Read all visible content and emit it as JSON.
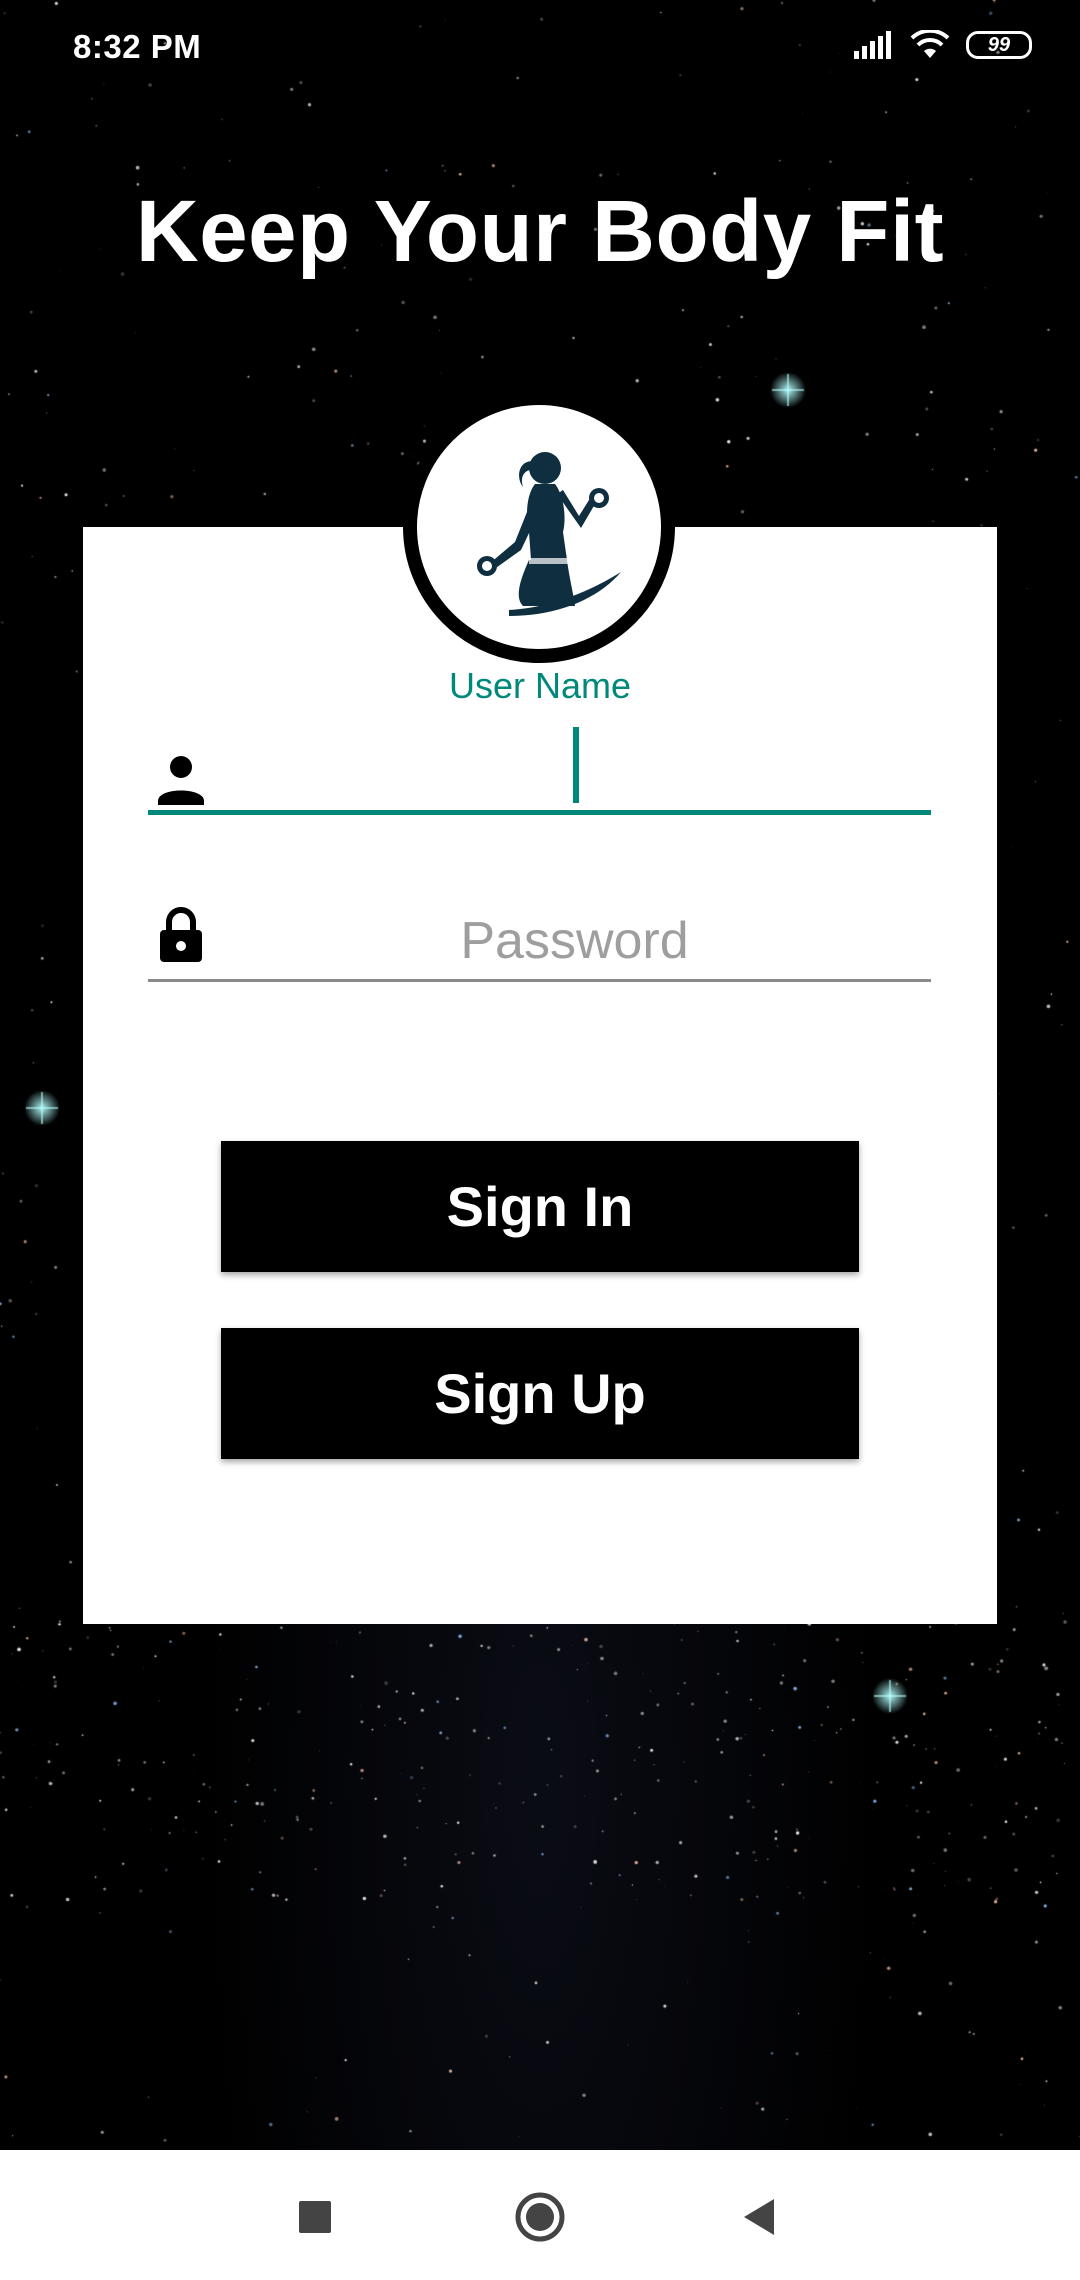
{
  "status_bar": {
    "time": "8:32 PM",
    "battery": "99",
    "signal_icon": "signal-icon",
    "wifi_icon": "wifi-icon"
  },
  "app": {
    "title": "Keep Your Body Fit"
  },
  "login_form": {
    "logo_icon": "fitness-woman-dumbbell-icon",
    "username": {
      "label": "User Name",
      "value": "",
      "icon": "person-icon"
    },
    "password": {
      "placeholder": "Password",
      "value": "",
      "icon": "lock-icon"
    },
    "sign_in_label": "Sign In",
    "sign_up_label": "Sign Up"
  },
  "nav_bar": {
    "recents_icon": "square-recents-icon",
    "home_icon": "circle-home-icon",
    "back_icon": "triangle-back-icon"
  },
  "colors": {
    "accent": "#00897b",
    "background": "#000000",
    "card": "#ffffff",
    "button": "#000000"
  }
}
